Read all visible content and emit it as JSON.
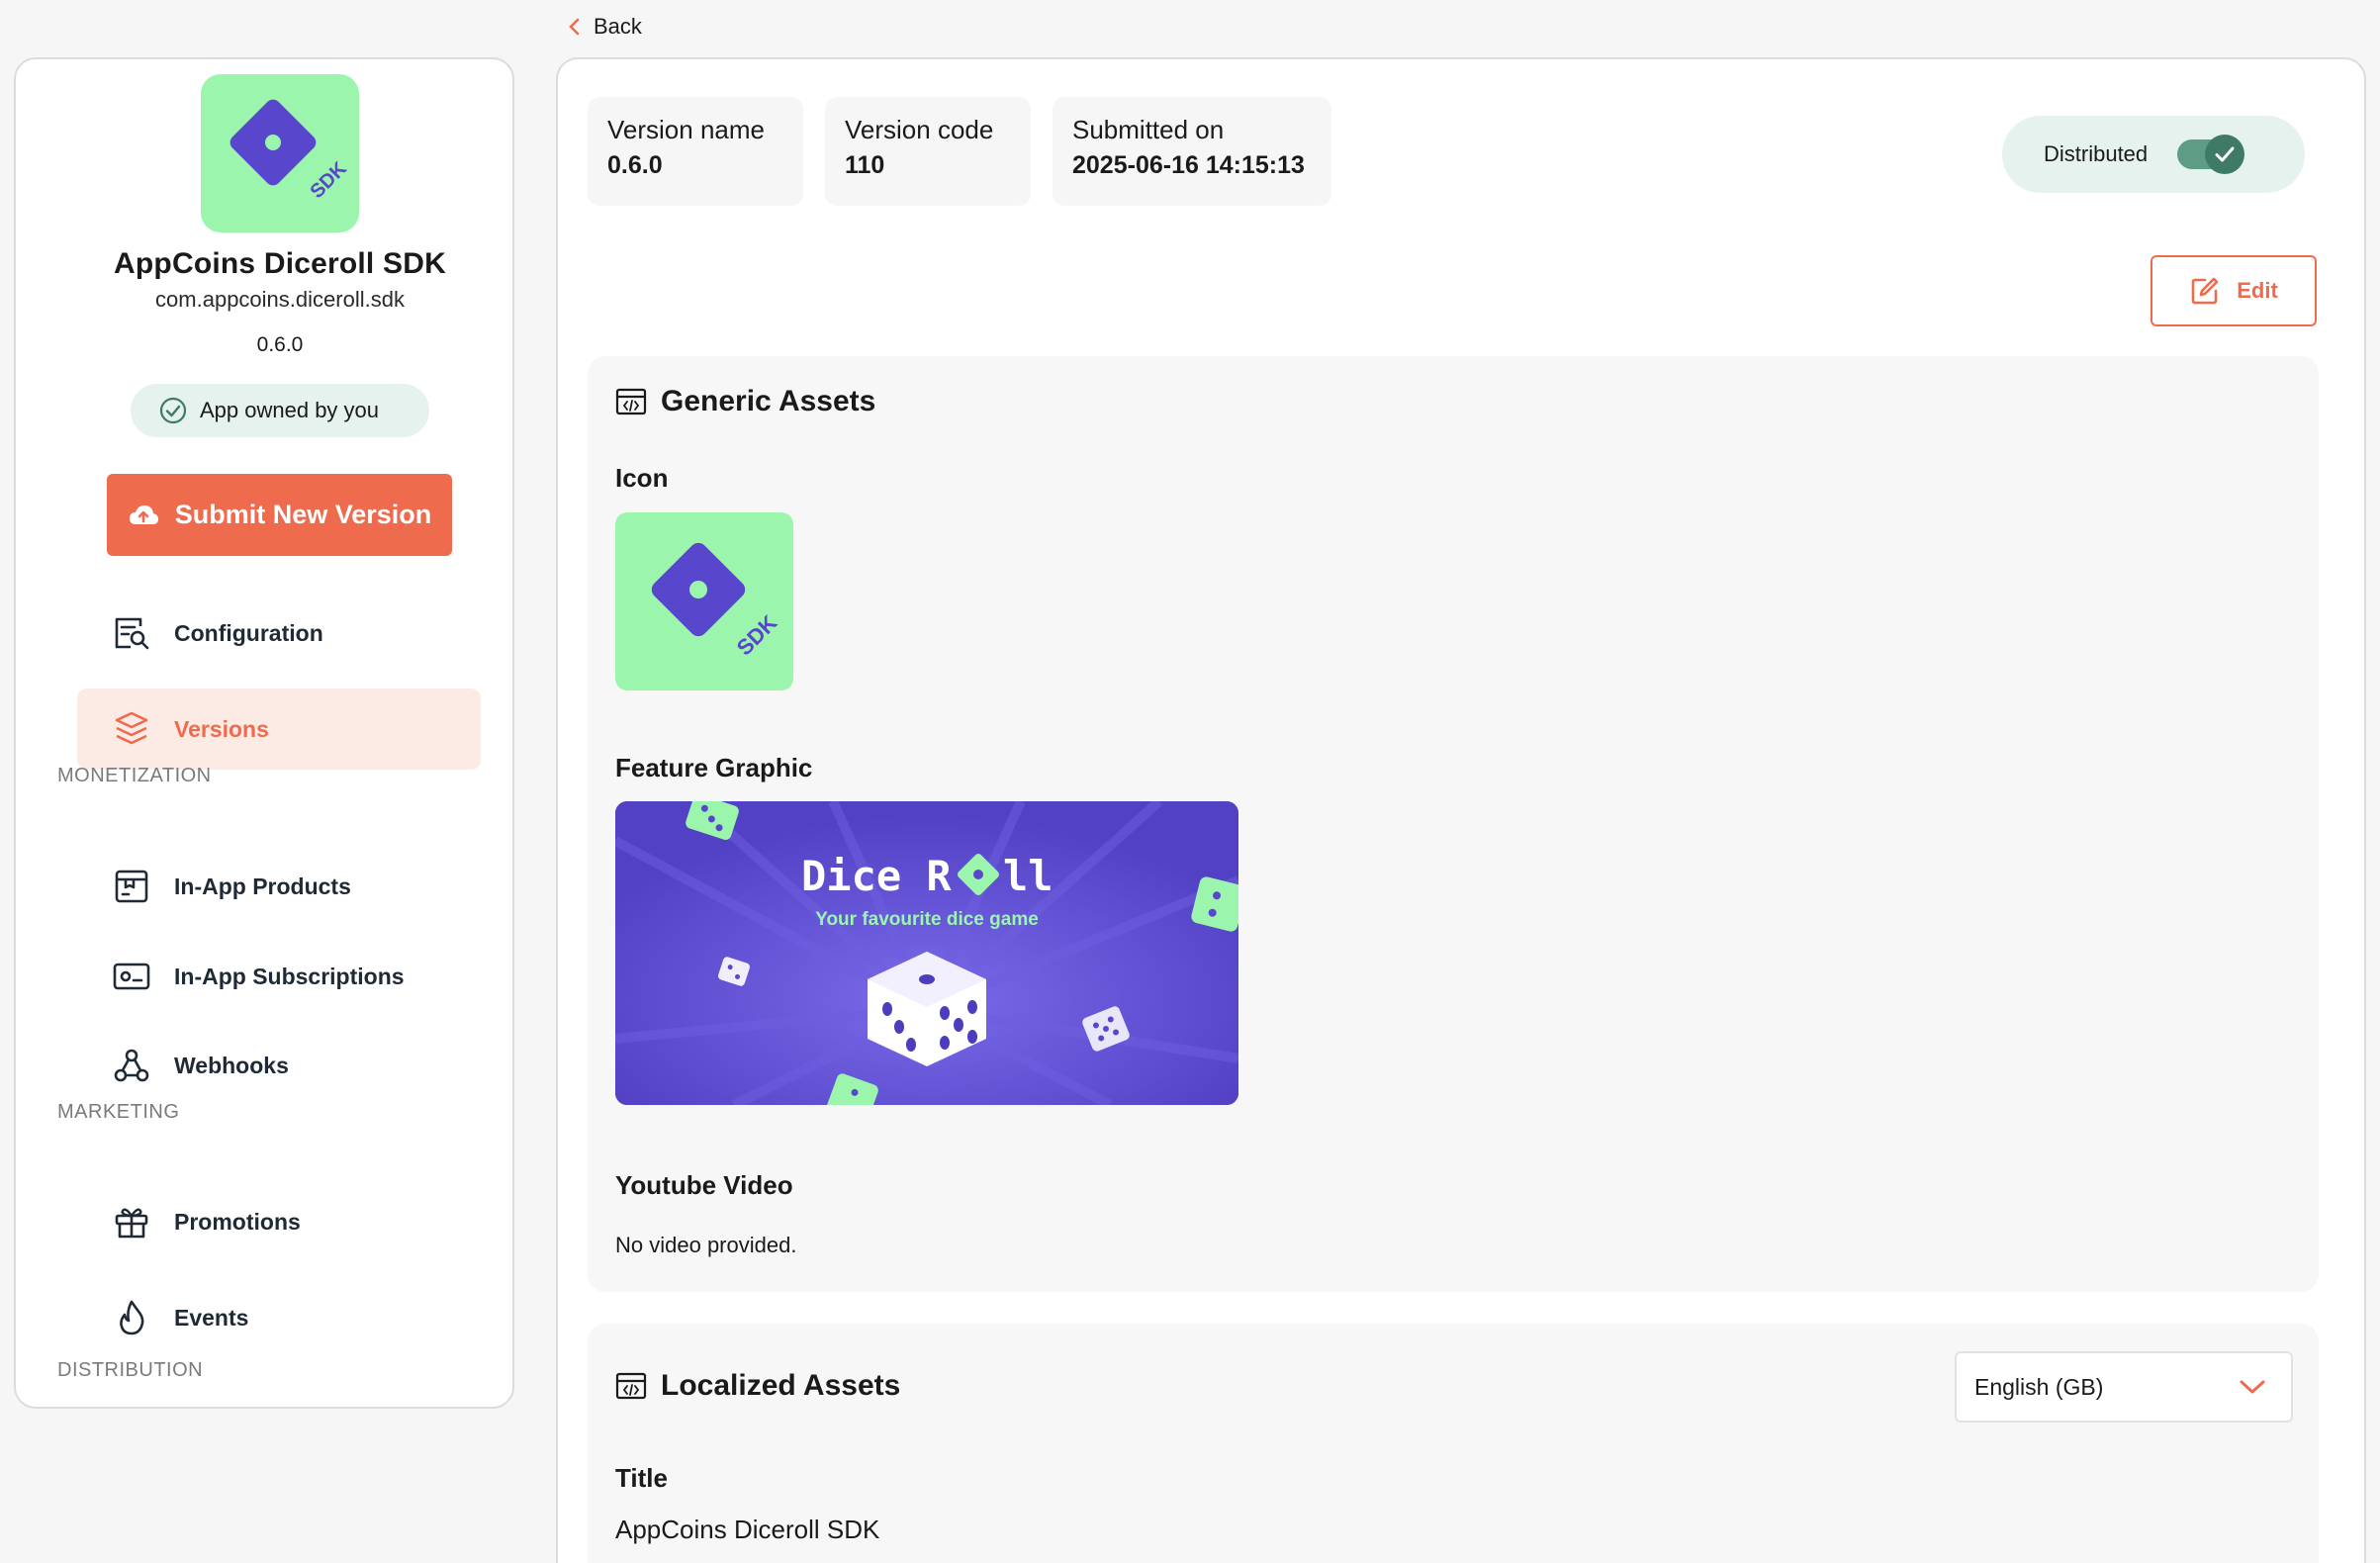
{
  "back": {
    "label": "Back"
  },
  "app": {
    "name": "AppCoins Diceroll SDK",
    "package": "com.appcoins.diceroll.sdk",
    "version": "0.6.0",
    "icon_text": "SDK",
    "owned_label": "App owned by you",
    "submit_label": "Submit New Version"
  },
  "nav": {
    "configuration": "Configuration",
    "versions": "Versions",
    "monetization_heading": "MONETIZATION",
    "in_app_products": "In-App Products",
    "in_app_subscriptions": "In-App Subscriptions",
    "webhooks": "Webhooks",
    "marketing_heading": "MARKETING",
    "promotions": "Promotions",
    "events": "Events",
    "distribution_heading": "DISTRIBUTION"
  },
  "version_info": {
    "name_label": "Version name",
    "name_value": "0.6.0",
    "code_label": "Version code",
    "code_value": "110",
    "submitted_label": "Submitted on",
    "submitted_value": "2025-06-16 14:15:13"
  },
  "distributed": {
    "label": "Distributed",
    "enabled": true
  },
  "edit": {
    "label": "Edit"
  },
  "generic_assets": {
    "heading": "Generic Assets",
    "icon_label": "Icon",
    "feature_label": "Feature Graphic",
    "feature_title_a": "Dice R",
    "feature_title_b": "ll",
    "feature_subtitle": "Your favourite dice game",
    "youtube_label": "Youtube Video",
    "youtube_value": "No video provided."
  },
  "localized_assets": {
    "heading": "Localized Assets",
    "language_selected": "English (GB)",
    "title_label": "Title",
    "title_value": "AppCoins Diceroll SDK"
  },
  "colors": {
    "accent": "#ee6b4d",
    "brand_green": "#9bf5ad",
    "brand_purple": "#5847cc",
    "toggle_on": "#3f7a66"
  }
}
